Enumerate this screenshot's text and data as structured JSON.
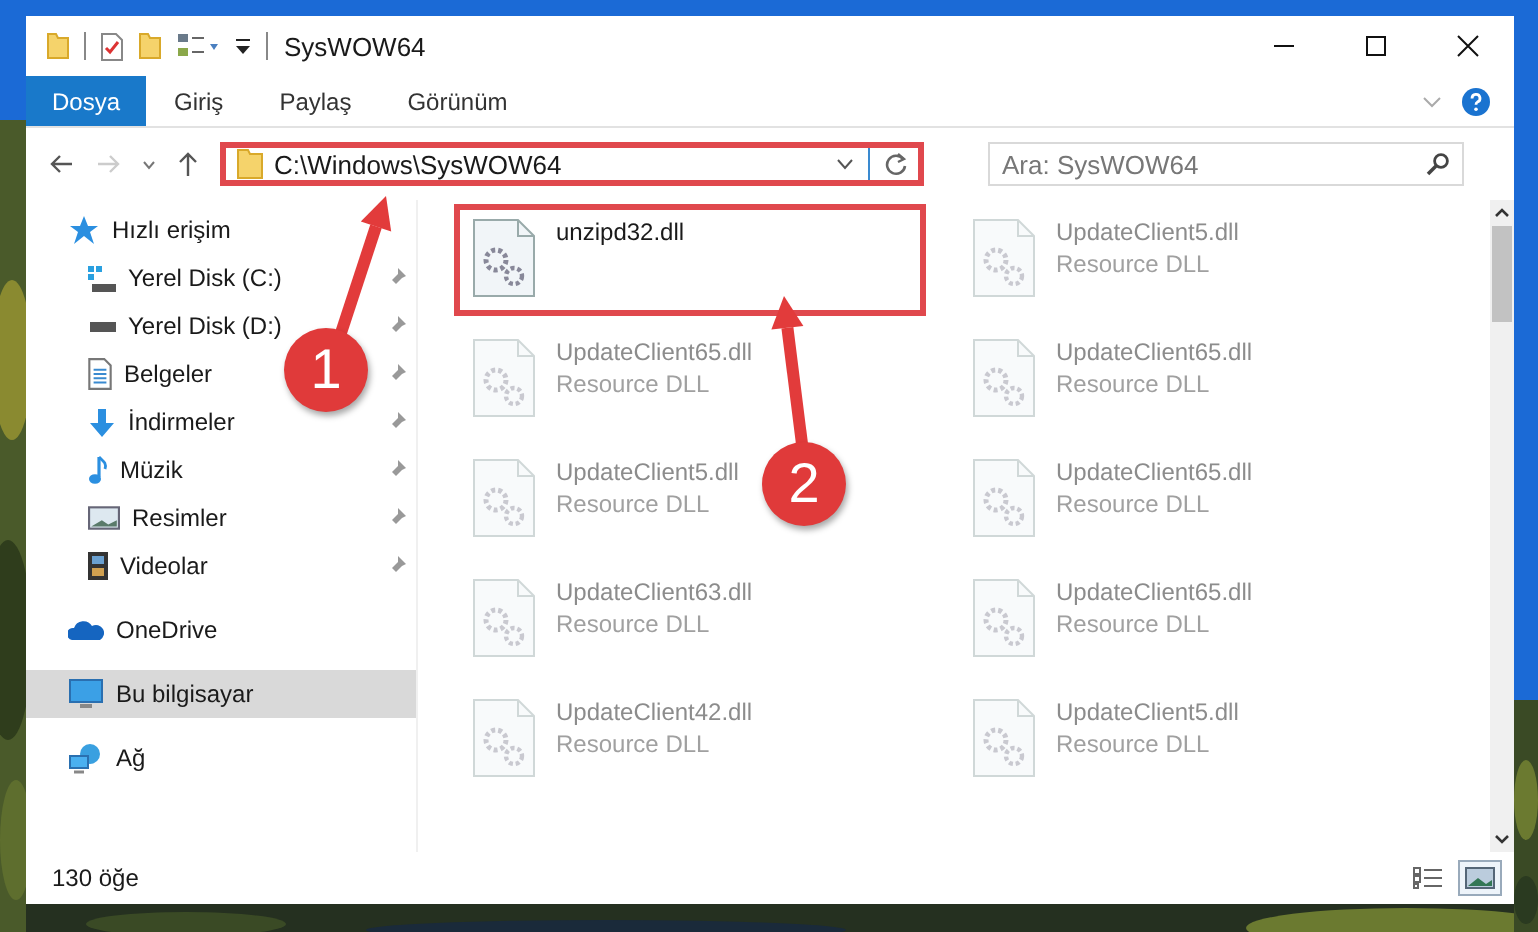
{
  "window": {
    "title": "SysWOW64"
  },
  "ribbon_tabs": [
    {
      "label": "Dosya",
      "selected": true
    },
    {
      "label": "Giriş",
      "selected": false
    },
    {
      "label": "Paylaş",
      "selected": false
    },
    {
      "label": "Görünüm",
      "selected": false
    }
  ],
  "address_bar": {
    "path": "C:\\Windows\\SysWOW64",
    "highlighted": true
  },
  "search": {
    "placeholder": "Ara: SysWOW64"
  },
  "sidebar": {
    "items": [
      {
        "label": "Hızlı erişim",
        "kind": "star",
        "selected": false,
        "children": [
          {
            "label": "Yerel Disk (C:)",
            "kind": "system-drive",
            "pinned": true
          },
          {
            "label": "Yerel Disk (D:)",
            "kind": "drive",
            "pinned": true
          },
          {
            "label": "Belgeler",
            "kind": "document",
            "pinned": true
          },
          {
            "label": "İndirmeler",
            "kind": "download",
            "pinned": true
          },
          {
            "label": "Müzik",
            "kind": "music",
            "pinned": true
          },
          {
            "label": "Resimler",
            "kind": "pictures",
            "pinned": true
          },
          {
            "label": "Videolar",
            "kind": "video",
            "pinned": true
          }
        ]
      },
      {
        "label": "OneDrive",
        "kind": "cloud",
        "selected": false
      },
      {
        "label": "Bu bilgisayar",
        "kind": "computer",
        "selected": true
      },
      {
        "label": "Ağ",
        "kind": "network",
        "selected": false
      }
    ]
  },
  "files": [
    {
      "name": "unzipd32.dll",
      "highlighted": true,
      "faded": false
    },
    {
      "name": "UpdateClient5.dll",
      "type": "Resource DLL",
      "highlighted": false,
      "faded": true
    },
    {
      "name": "UpdateClient65.dll",
      "type": "Resource DLL",
      "highlighted": false,
      "faded": true
    },
    {
      "name": "UpdateClient65.dll",
      "type": "Resource DLL",
      "highlighted": false,
      "faded": true
    },
    {
      "name": "UpdateClient5.dll",
      "type": "Resource DLL",
      "highlighted": false,
      "faded": true
    },
    {
      "name": "UpdateClient65.dll",
      "type": "Resource DLL",
      "highlighted": false,
      "faded": true
    },
    {
      "name": "UpdateClient63.dll",
      "type": "Resource DLL",
      "highlighted": false,
      "faded": true
    },
    {
      "name": "UpdateClient65.dll",
      "type": "Resource DLL",
      "highlighted": false,
      "faded": true
    },
    {
      "name": "UpdateClient42.dll",
      "type": "Resource DLL",
      "highlighted": false,
      "faded": true
    },
    {
      "name": "UpdateClient5.dll",
      "type": "Resource DLL",
      "highlighted": false,
      "faded": true
    }
  ],
  "status_bar": {
    "item_count": "130 öğe",
    "view_buttons": [
      {
        "kind": "details",
        "selected": false
      },
      {
        "kind": "large-icons",
        "selected": true
      }
    ]
  },
  "annotations": [
    {
      "label": "1"
    },
    {
      "label": "2"
    }
  ]
}
